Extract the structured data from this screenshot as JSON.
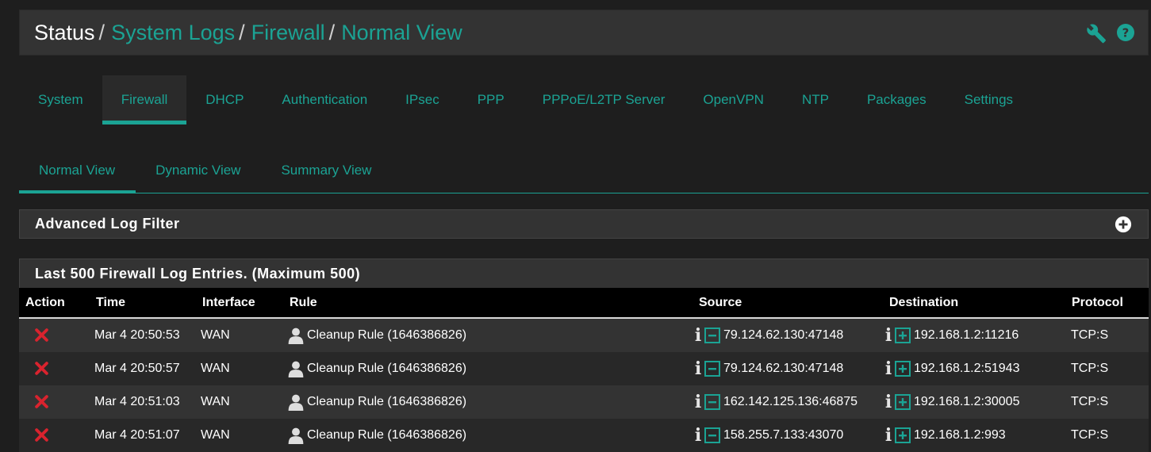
{
  "breadcrumb": {
    "home": "Status",
    "sep": "/",
    "links": [
      "System Logs",
      "Firewall",
      "Normal View"
    ]
  },
  "header_icons": [
    "wrench-icon",
    "help-circle-icon"
  ],
  "colors": {
    "accent": "#1ba394",
    "block": "#d9232e",
    "panel": "#333333",
    "background": "#1e1e1e"
  },
  "tabs": [
    {
      "label": "System",
      "active": false
    },
    {
      "label": "Firewall",
      "active": true
    },
    {
      "label": "DHCP",
      "active": false
    },
    {
      "label": "Authentication",
      "active": false
    },
    {
      "label": "IPsec",
      "active": false
    },
    {
      "label": "PPP",
      "active": false
    },
    {
      "label": "PPPoE/L2TP Server",
      "active": false
    },
    {
      "label": "OpenVPN",
      "active": false
    },
    {
      "label": "NTP",
      "active": false
    },
    {
      "label": "Packages",
      "active": false
    },
    {
      "label": "Settings",
      "active": false
    }
  ],
  "subtabs": [
    {
      "label": "Normal View",
      "active": true
    },
    {
      "label": "Dynamic View",
      "active": false
    },
    {
      "label": "Summary View",
      "active": false
    }
  ],
  "filter_panel": {
    "title": "Advanced Log Filter"
  },
  "log_panel": {
    "title": "Last 500 Firewall Log Entries. (Maximum 500)",
    "columns": [
      "Action",
      "Time",
      "Interface",
      "Rule",
      "Source",
      "Destination",
      "Protocol"
    ],
    "rows": [
      {
        "action": "block",
        "time": "Mar 4 20:50:53",
        "interface": "WAN",
        "rule": "Cleanup Rule (1646386826)",
        "source": "79.124.62.130:47148",
        "destination": "192.168.1.2:11216",
        "protocol": "TCP:S"
      },
      {
        "action": "block",
        "time": "Mar 4 20:50:57",
        "interface": "WAN",
        "rule": "Cleanup Rule (1646386826)",
        "source": "79.124.62.130:47148",
        "destination": "192.168.1.2:51943",
        "protocol": "TCP:S"
      },
      {
        "action": "block",
        "time": "Mar 4 20:51:03",
        "interface": "WAN",
        "rule": "Cleanup Rule (1646386826)",
        "source": "162.142.125.136:46875",
        "destination": "192.168.1.2:30005",
        "protocol": "TCP:S"
      },
      {
        "action": "block",
        "time": "Mar 4 20:51:07",
        "interface": "WAN",
        "rule": "Cleanup Rule (1646386826)",
        "source": "158.255.7.133:43070",
        "destination": "192.168.1.2:993",
        "protocol": "TCP:S"
      }
    ]
  }
}
